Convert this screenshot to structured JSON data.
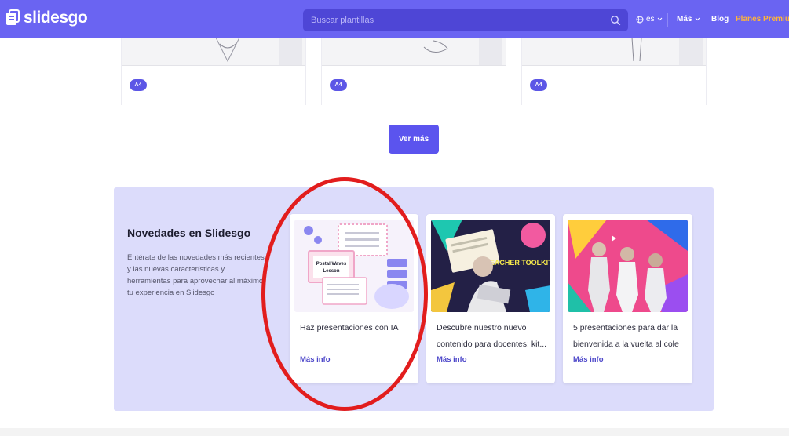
{
  "header": {
    "logo_text": "slidesgo",
    "search_placeholder": "Buscar plantillas",
    "language": "es",
    "nav_more": "Más",
    "nav_blog": "Blog",
    "nav_premium": "Planes Premium"
  },
  "top_cards": [
    {
      "badge": "A4"
    },
    {
      "badge": "A4"
    },
    {
      "badge": "A4"
    }
  ],
  "ver_mas_label": "Ver más",
  "novedades": {
    "title": "Novedades en Slidesgo",
    "description": "Entérate de las novedades más recientes y las nuevas características y herramientas para aprovechar al máximo tu experiencia en Slidesgo",
    "cards": [
      {
        "title": "Haz presentaciones con IA",
        "link": "Más info",
        "image_text_1": "Postal Waves",
        "image_text_2": "Lesson"
      },
      {
        "title": "Descubre nuestro nuevo contenido para docentes: kit...",
        "link": "Más info",
        "image_text": "TEACHER TOOLKIT"
      },
      {
        "title": "5 presentaciones para dar la bienvenida a la vuelta al cole",
        "link": "Más info"
      }
    ]
  },
  "colors": {
    "header_bg": "#6a64f2",
    "primary_button": "#5b54ee",
    "section_bg": "#dcdcfb",
    "premium": "#ffb43a",
    "annotation": "#e21d1d"
  }
}
